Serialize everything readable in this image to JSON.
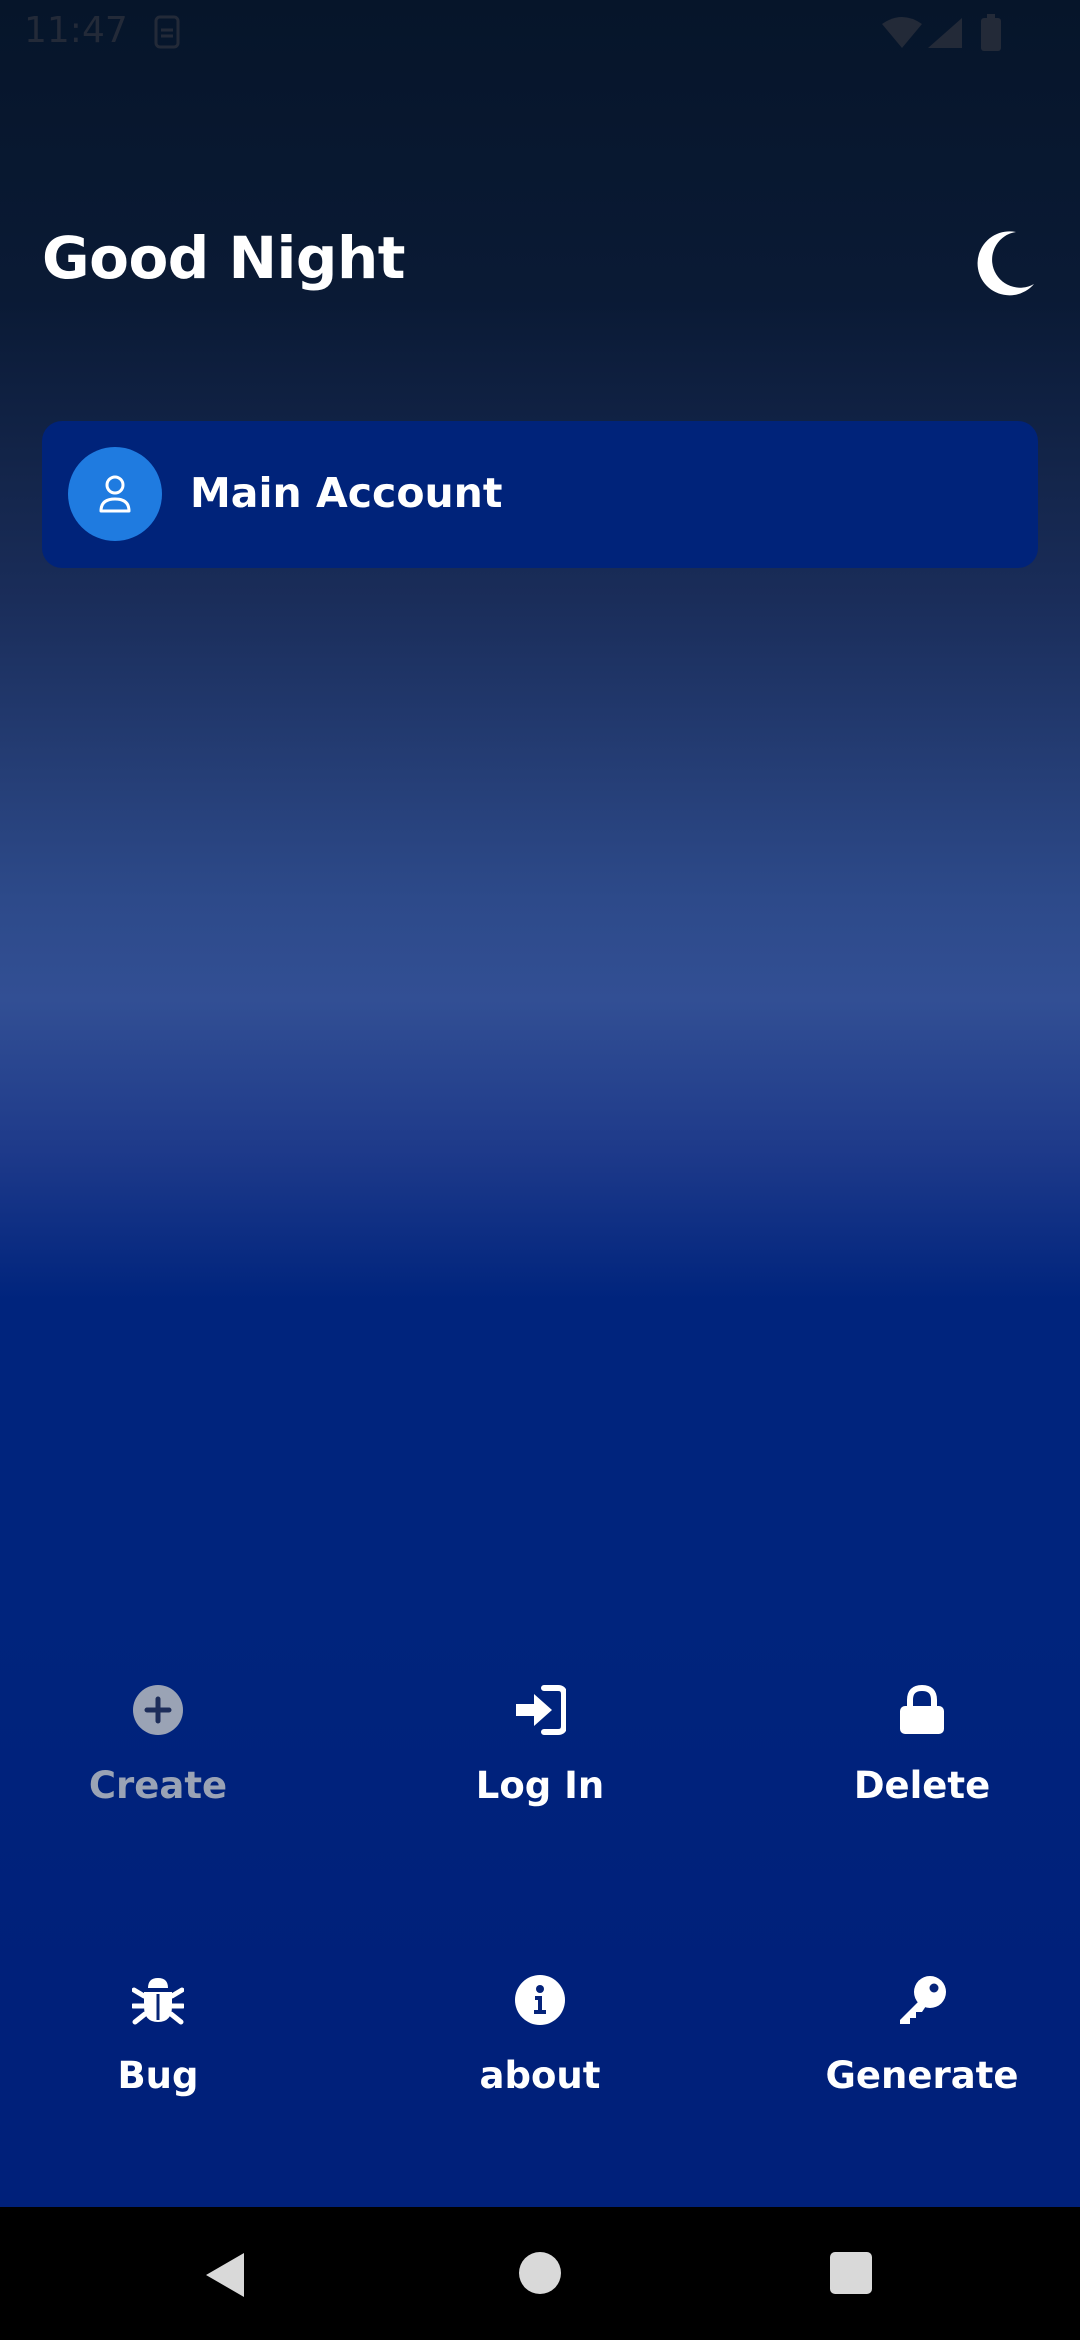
{
  "status_bar": {
    "time": "11:47",
    "icons": [
      "sim-icon",
      "wifi-icon",
      "signal-icon",
      "battery-icon"
    ]
  },
  "header": {
    "greeting": "Good Night",
    "theme_icon": "moon-icon"
  },
  "accounts": [
    {
      "label": "Main Account",
      "icon": "user-icon"
    }
  ],
  "actions": [
    {
      "label": "Create",
      "icon": "plus-circle-icon",
      "enabled": false
    },
    {
      "label": "Log In",
      "icon": "sign-in-icon",
      "enabled": true
    },
    {
      "label": "Delete",
      "icon": "lock-icon",
      "enabled": true
    },
    {
      "label": "Bug",
      "icon": "bug-icon",
      "enabled": true
    },
    {
      "label": "about",
      "icon": "info-icon",
      "enabled": true
    },
    {
      "label": "Generate",
      "icon": "key-icon",
      "enabled": true
    }
  ],
  "nav_bar": {
    "buttons": [
      "back-icon",
      "home-icon",
      "recents-icon"
    ]
  },
  "colors": {
    "card": "#00237a",
    "avatar": "#1f7be0",
    "text": "#ffffff",
    "disabled_text": "#9aa3b5",
    "nav_bar": "#000000"
  }
}
